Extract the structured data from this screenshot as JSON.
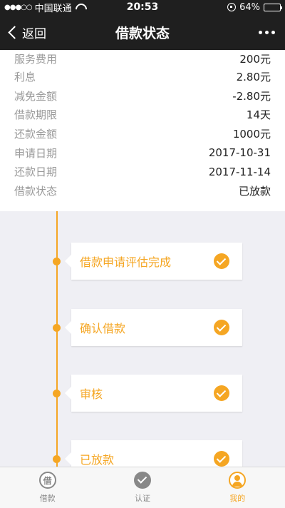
{
  "status_bar": {
    "carrier": "中国联通",
    "time": "20:53",
    "battery": "64%"
  },
  "nav": {
    "back_label": "返回",
    "title": "借款状态"
  },
  "info": [
    {
      "label": "服务费用",
      "value": "200元"
    },
    {
      "label": "利息",
      "value": "2.80元"
    },
    {
      "label": "减免金额",
      "value": "-2.80元"
    },
    {
      "label": "借款期限",
      "value": "14天"
    },
    {
      "label": "还款金额",
      "value": "1000元"
    },
    {
      "label": "申请日期",
      "value": "2017-10-31"
    },
    {
      "label": "还款日期",
      "value": "2017-11-14"
    },
    {
      "label": "借款状态",
      "value": "已放款"
    }
  ],
  "timeline": [
    {
      "label": "借款申请评估完成",
      "done": true
    },
    {
      "label": "确认借款",
      "done": true
    },
    {
      "label": "审核",
      "done": true
    },
    {
      "label": "已放款",
      "done": true
    }
  ],
  "tabs": [
    {
      "label": "借款",
      "icon_text": "借",
      "active": false
    },
    {
      "label": "认证",
      "active": false
    },
    {
      "label": "我的",
      "active": true
    }
  ],
  "colors": {
    "accent": "#f5a623",
    "nav_bg": "#1f1f1f"
  }
}
